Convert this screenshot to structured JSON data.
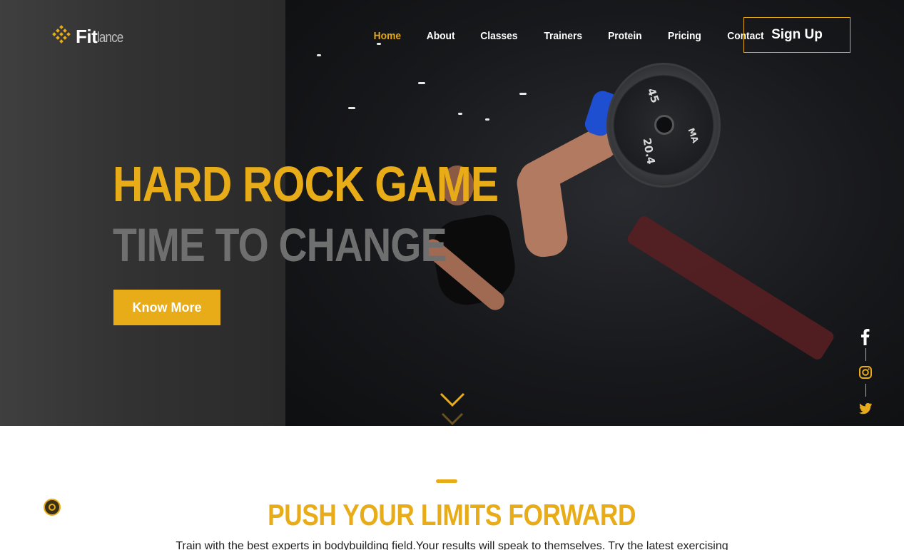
{
  "brand": {
    "name_strong": "Fit",
    "name_light": "lance"
  },
  "nav": {
    "items": [
      {
        "label": "Home",
        "active": true
      },
      {
        "label": "About",
        "active": false
      },
      {
        "label": "Classes",
        "active": false
      },
      {
        "label": "Trainers",
        "active": false
      },
      {
        "label": "Protein",
        "active": false
      },
      {
        "label": "Pricing",
        "active": false
      },
      {
        "label": "Contact",
        "active": false
      }
    ],
    "signup_label": "Sign Up"
  },
  "hero": {
    "title": "HARD ROCK GAME",
    "subtitle": "TIME TO CHANGE",
    "cta_label": "Know More",
    "plate_labels": [
      "45",
      "20.4",
      "MA"
    ]
  },
  "social": {
    "icons": [
      "facebook-icon",
      "instagram-icon",
      "twitter-icon"
    ]
  },
  "section": {
    "title": "PUSH YOUR LIMITS FORWARD",
    "text": "Train with the best experts in bodybuilding field.Your results will speak to themselves. Try the latest exercising"
  },
  "colors": {
    "accent": "#e9ac19",
    "nav_active": "#e5a918",
    "subtitle_gray": "#6f6f6f",
    "hero_dark": "#141518"
  }
}
